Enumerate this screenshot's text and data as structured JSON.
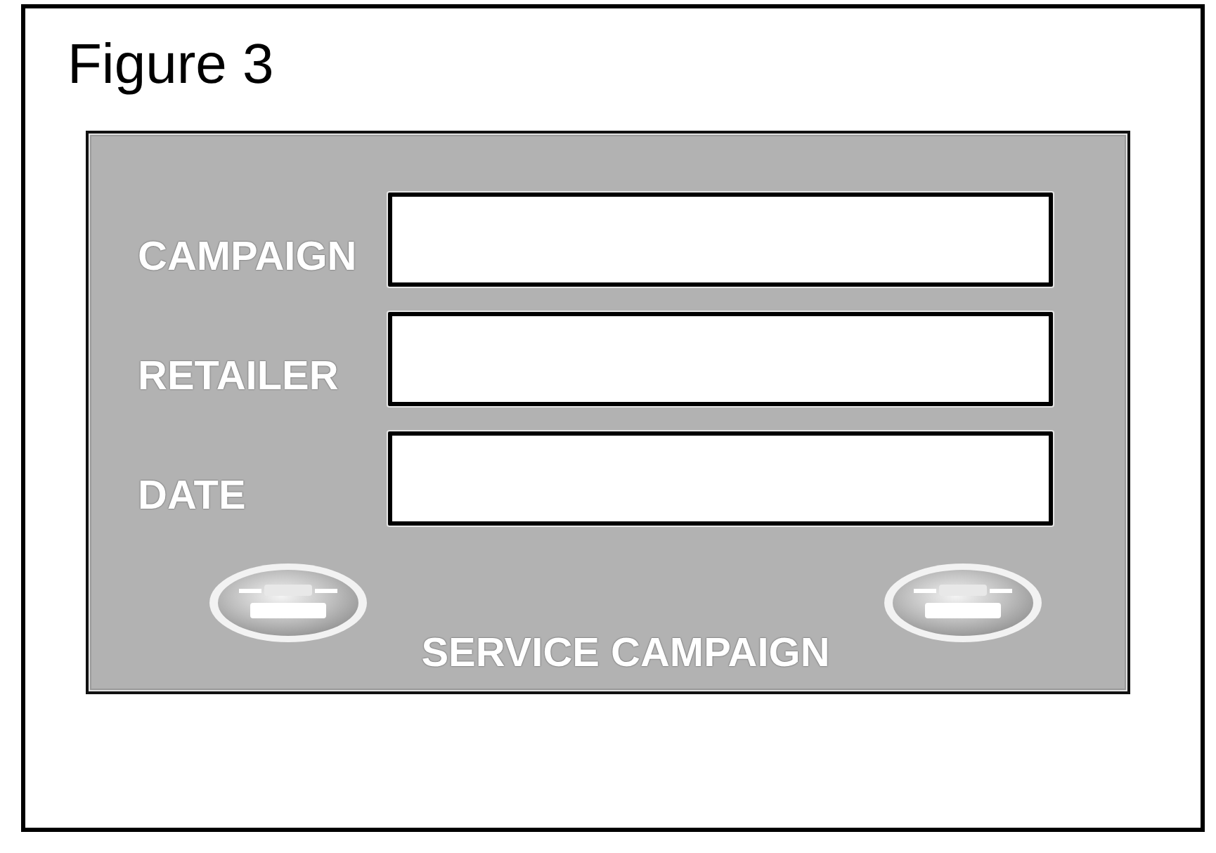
{
  "figure": {
    "title": "Figure 3"
  },
  "form": {
    "fields": [
      {
        "label": "CAMPAIGN"
      },
      {
        "label": "RETAILER"
      },
      {
        "label": "DATE"
      }
    ],
    "footer": {
      "caption": "SERVICE CAMPAIGN"
    }
  }
}
